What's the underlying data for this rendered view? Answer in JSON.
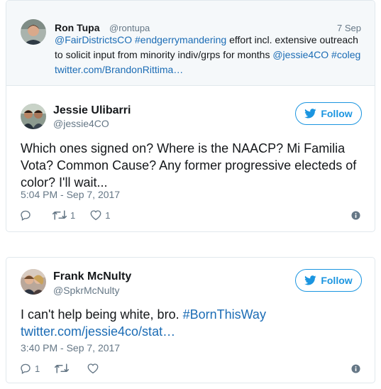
{
  "quoted_tweet": {
    "author_name": "Ron Tupa",
    "author_handle": "@rontupa",
    "date": "7 Sep",
    "text_parts": [
      {
        "text": "@FairDistrictsCO",
        "link": true
      },
      {
        "text": " ",
        "link": false
      },
      {
        "text": "#endgerrymandering",
        "link": true
      },
      {
        "text": " effort incl. extensive outreach to solicit input from minority indiv/grps for months ",
        "link": false
      },
      {
        "text": "@jessie4CO",
        "link": true
      },
      {
        "text": " ",
        "link": false
      },
      {
        "text": "#coleg",
        "link": true
      },
      {
        "text": " ",
        "link": false
      },
      {
        "text": "twitter.com/BrandonRittima…",
        "link": true
      }
    ]
  },
  "tweet1": {
    "author_name": "Jessie Ulibarri",
    "author_handle": "@jessie4CO",
    "follow_label": "Follow",
    "text": "Which ones signed on? Where is the NAACP? Mi Familia Vota? Common Cause? Any former progressive electeds of color? I'll wait...",
    "timestamp": "5:04 PM - Sep 7, 2017",
    "reply_count": "",
    "retweet_count": "1",
    "like_count": "1"
  },
  "tweet2": {
    "author_name": "Frank McNulty",
    "author_handle": "@SpkrMcNulty",
    "follow_label": "Follow",
    "text_main": "I can't help being white, bro. ",
    "hashtag": "#BornThisWay",
    "link": "twitter.com/jessie4co/stat…",
    "timestamp": "3:40 PM - Sep 7, 2017",
    "reply_count": "1",
    "retweet_count": "",
    "like_count": ""
  },
  "colors": {
    "link": "#1b6cb5",
    "twitter_blue": "#1b95e0",
    "muted": "#657786",
    "border": "#e1e8ed"
  }
}
